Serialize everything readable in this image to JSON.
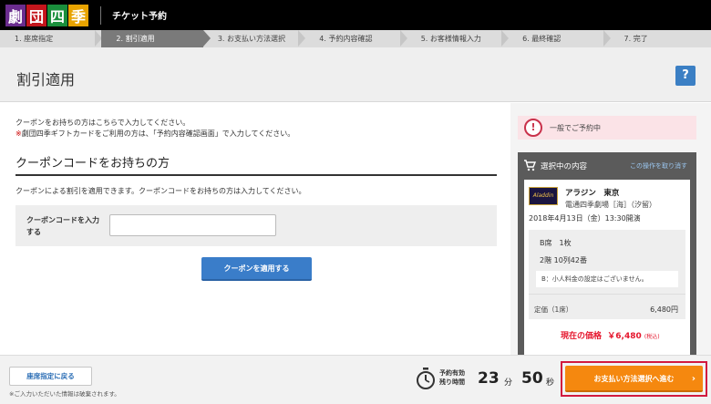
{
  "header": {
    "logo_chars": [
      "劇",
      "団",
      "四",
      "季"
    ],
    "app_title": "チケット予約"
  },
  "steps": [
    {
      "label": "1. 座席指定",
      "active": false
    },
    {
      "label": "2. 割引適用",
      "active": true
    },
    {
      "label": "3. お支払い方法選択",
      "active": false
    },
    {
      "label": "4. 予約内容確認",
      "active": false
    },
    {
      "label": "5. お客様情報入力",
      "active": false
    },
    {
      "label": "6. 最終確認",
      "active": false
    },
    {
      "label": "7. 完了",
      "active": false
    }
  ],
  "page": {
    "title": "割引適用",
    "help_label": "?"
  },
  "coupon": {
    "intro_line1": "クーポンをお持ちの方はこちらで入力してください。",
    "intro_line2_mark": "※",
    "intro_line2": "劇団四季ギフトカードをご利用の方は、「予約内容確認画面」で入力してください。",
    "section_title": "クーポンコードをお持ちの方",
    "description": "クーポンによる割引を適用できます。クーポンコードをお持ちの方は入力してください。",
    "field_label": "クーポンコードを入力する",
    "field_value": "",
    "apply_button": "クーポンを適用する"
  },
  "sidebar": {
    "notice_icon": "!",
    "notice_text": "一般でご予約中",
    "selection_title": "選択中の内容",
    "cancel_link": "この操作を取り消す",
    "thumbnail_text": "Aladdin",
    "show_name": "アラジン　東京",
    "venue": "電通四季劇場［海］（汐留）",
    "datetime": "2018年4月13日（金）13:30開演",
    "seat_class": "B席　1枚",
    "seat_position": "2階 10列42番",
    "child_note": "B：小人料金の設定はございません。",
    "price_label": "定価（1席）",
    "price_value": "6,480円",
    "current_price_label": "現在の価格",
    "current_price_value": "￥6,480",
    "current_price_tax": "(税込)"
  },
  "footer": {
    "back_button": "座席指定に戻る",
    "back_note": "※ご入力いただいた情報は破棄されます。",
    "timer_label_line1": "予約有効",
    "timer_label_line2": "残り時間",
    "minutes": "23",
    "minutes_unit": "分",
    "seconds": "50",
    "seconds_unit": "秒",
    "proceed_button": "お支払い方法選択へ進む",
    "proceed_chevron": "›"
  },
  "colors": {
    "primary_button": "#3a7dc9",
    "proceed_button": "#f5880f",
    "highlight_border": "#d11a3f",
    "price_red": "#e5162d",
    "notice_bg": "#fbe3e7"
  }
}
